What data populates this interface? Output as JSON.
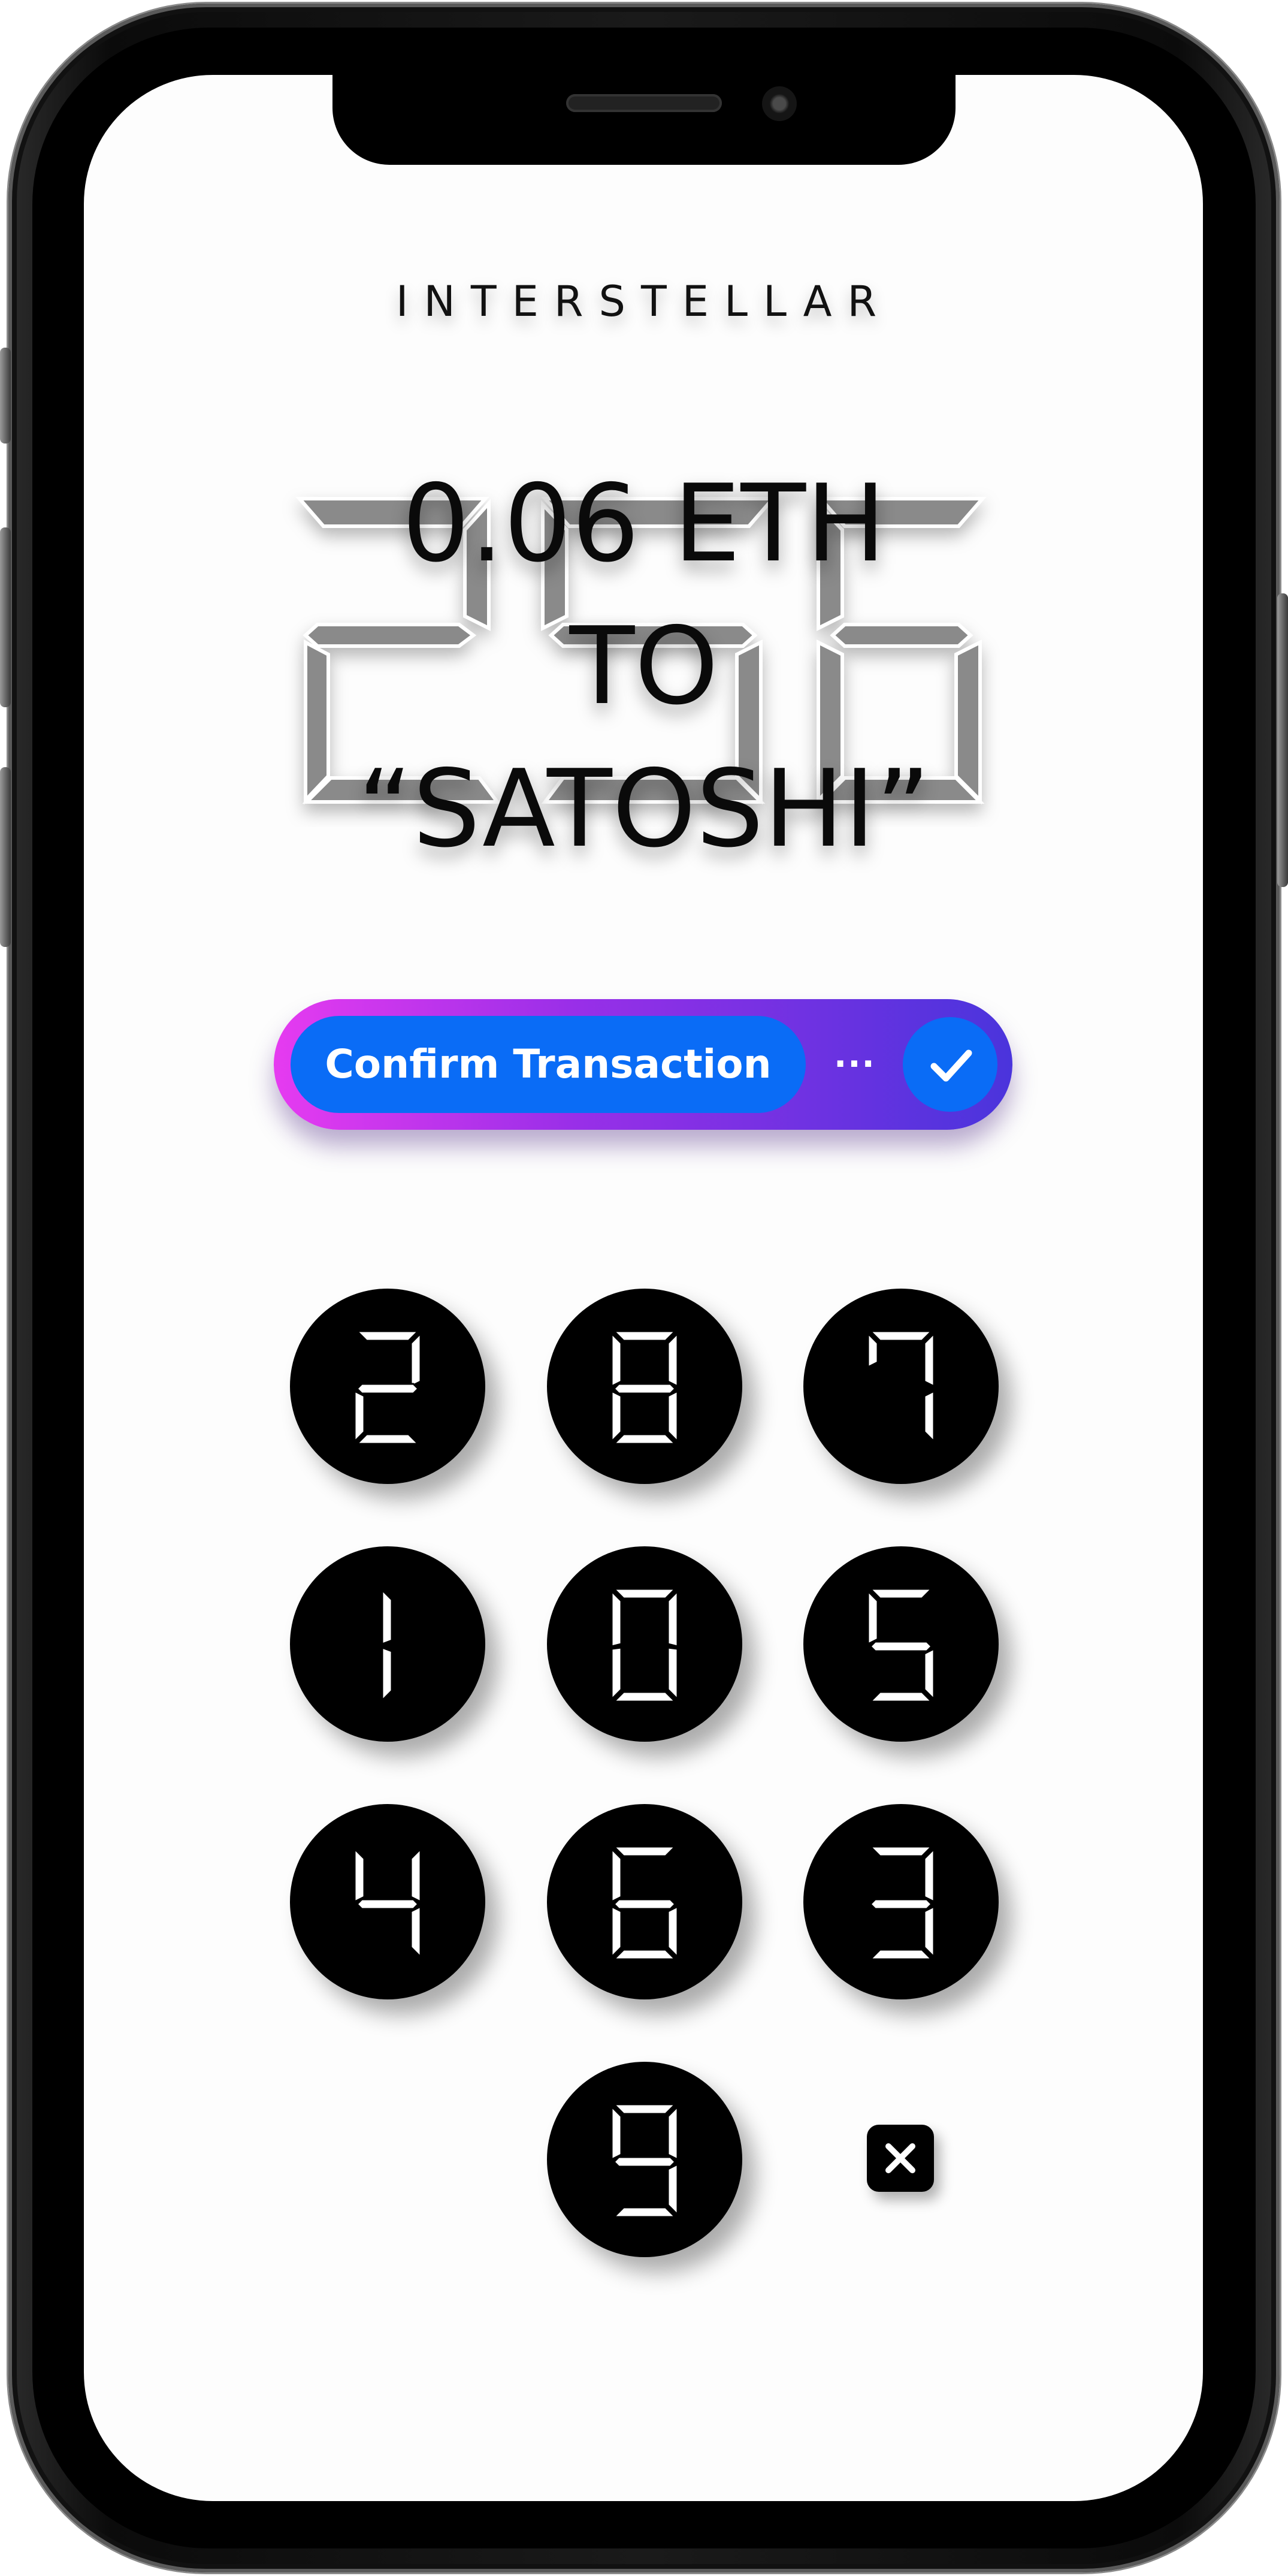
{
  "brand": {
    "name": "INTERSTELLAR"
  },
  "background_number": "256",
  "transaction": {
    "line1": "0.06 ETH",
    "line2": "TO",
    "line3": "“SATOSHI”"
  },
  "confirm": {
    "label": "Confirm Transaction",
    "dots": "···",
    "check_icon": "checkmark-icon"
  },
  "keypad": {
    "keys": [
      "2",
      "8",
      "7",
      "1",
      "0",
      "5",
      "4",
      "6",
      "3",
      "9"
    ],
    "delete_icon": "close-icon"
  },
  "colors": {
    "primary_blue": "#0a6cf6",
    "gradient_start": "#e63bf0",
    "gradient_end": "#4a34dc",
    "key_background": "#000000",
    "key_digit": "#ffffff",
    "background_number": "#8a8a8a"
  }
}
